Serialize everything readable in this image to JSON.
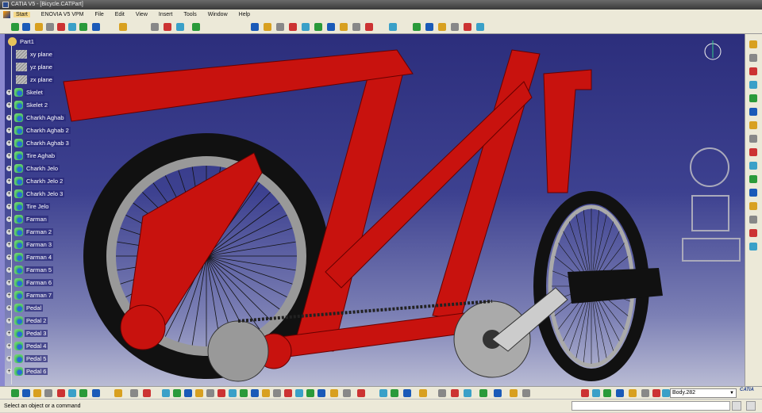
{
  "window": {
    "title": "CATIA V5 - [Bicycle.CATPart]"
  },
  "menu": [
    "Start",
    "ENOVIA V5 VPM",
    "File",
    "Edit",
    "View",
    "Insert",
    "Tools",
    "Window",
    "Help"
  ],
  "tree": [
    "Part1",
    "xy plane",
    "yz plane",
    "zx plane",
    "Skelet",
    "Skelet 2",
    "Charkh Aghab",
    "Charkh Aghab 2",
    "Charkh Aghab 3",
    "Tire Aghab",
    "Charkh Jelo",
    "Charkh Jelo 2",
    "Charkh Jelo 3",
    "Tire Jelo",
    "Farman",
    "Farman 2",
    "Farman 3",
    "Farman 4",
    "Farman 5",
    "Farman 6",
    "Farman 7",
    "Pedal",
    "Pedal 2",
    "Pedal 3",
    "Pedal 4",
    "Pedal 5",
    "Pedal 6"
  ],
  "bottom": {
    "current_body": "Body.282",
    "logo": "CATIA"
  },
  "status": {
    "message": "Select an object or a command",
    "command_input": ""
  },
  "colors": {
    "frame": "#c8120e",
    "background_top": "#2c2e7c",
    "background_bottom": "#b9bbd4"
  }
}
